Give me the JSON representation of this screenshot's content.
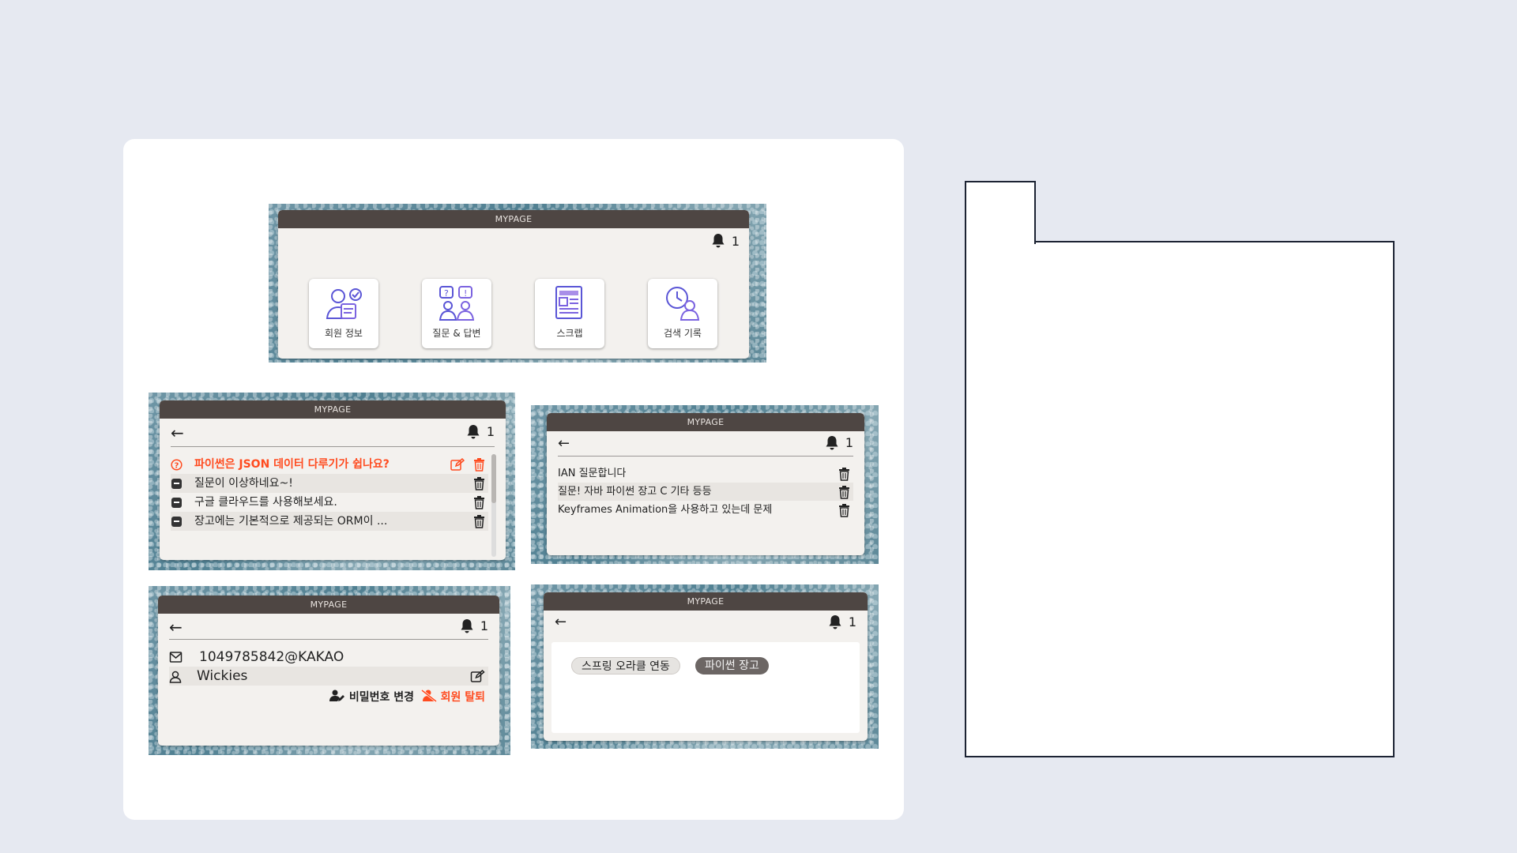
{
  "shot1": {
    "title": "MYPAGE",
    "bell_count": "1",
    "tiles": [
      {
        "label": "회원 정보",
        "icon": "member-info-icon"
      },
      {
        "label": "질문 & 답변",
        "icon": "qa-icon"
      },
      {
        "label": "스크랩",
        "icon": "scrap-icon"
      },
      {
        "label": "검색 기록",
        "icon": "search-history-icon"
      }
    ]
  },
  "shot2": {
    "title": "MYPAGE",
    "bell_count": "1",
    "items": [
      {
        "text": "파이썬은 JSON 데이터 다루기가 쉽나요?"
      },
      {
        "text": "질문이 이상하네요~!"
      },
      {
        "text": "구글 클라우드를 사용해보세요."
      },
      {
        "text": "장고에는 기본적으로 제공되는 ORM이 ..."
      }
    ]
  },
  "shot3": {
    "title": "MYPAGE",
    "bell_count": "1",
    "items": [
      {
        "text": "IAN 질문합니다"
      },
      {
        "text": "질문! 자바 파이썬 장고 C 기타 등등"
      },
      {
        "text": "Keyframes Animation을 사용하고 있는데 문제"
      }
    ]
  },
  "shot4": {
    "title": "MYPAGE",
    "bell_count": "1",
    "email": "1049785842@KAKAO",
    "nickname": "Wickies",
    "change_password": "비밀번호 변경",
    "withdraw": "회원 탈퇴"
  },
  "shot5": {
    "title": "MYPAGE",
    "bell_count": "1",
    "tags": [
      "스프링 오라클 연동",
      "파이썬 장고"
    ]
  },
  "colors": {
    "accent_red": "#ff4b1f",
    "titlebar": "#4e4643",
    "panel": "#f3f1ee",
    "page_bg": "#e6e9f1"
  }
}
